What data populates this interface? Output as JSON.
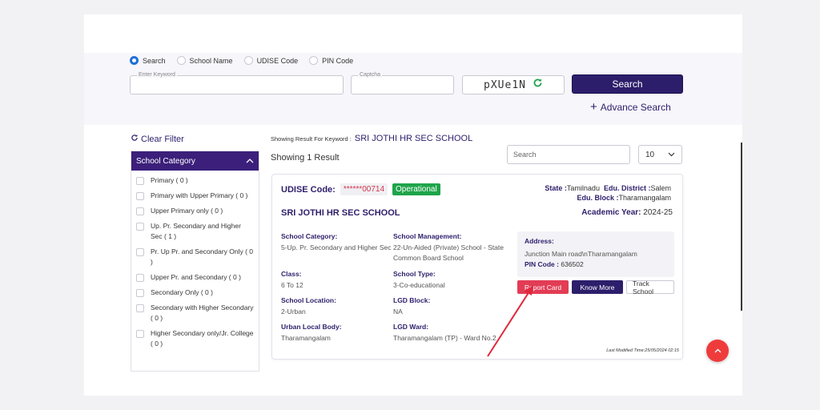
{
  "search_options": {
    "selected": "Search",
    "options": [
      "Search",
      "School Name",
      "UDISE Code",
      "PIN Code"
    ]
  },
  "search_form": {
    "keyword_label": "Enter Keyword",
    "captcha_label": "Captcha",
    "captcha_text": "pXUe1N",
    "search_button": "Search",
    "advance_search": "Advance Search"
  },
  "filter": {
    "clear_filter": "Clear Filter",
    "section_title": "School Category",
    "items": [
      "Primary ( 0 )",
      "Primary with Upper Primary ( 0 )",
      "Upper Primary only ( 0 )",
      "Up. Pr. Secondary and Higher Sec ( 1 )",
      "Pr. Up Pr. and Secondary Only ( 0 )",
      "Upper Pr. and Secondary ( 0 )",
      "Secondary Only ( 0 )",
      "Secondary with Higher Secondary ( 0 )",
      "Higher Secondary only/Jr. College ( 0 )"
    ]
  },
  "results": {
    "keyword_prefix": "Showing Result For Keyword :",
    "keyword": "SRI JOTHI HR SEC SCHOOL",
    "count_text": "Showing 1 Result",
    "search_placeholder": "Search",
    "per_page": "10"
  },
  "school": {
    "udise_label": "UDISE Code:",
    "udise_value": "******00714",
    "status": "Operational",
    "state_label": "State :",
    "state": "Tamilnadu",
    "district_label": "Edu. District :",
    "district": "Salem",
    "block_label": "Edu. Block :",
    "block": "Tharamangalam",
    "name": "SRI JOTHI HR SEC SCHOOL",
    "academic_year_label": "Academic Year:",
    "academic_year": "2024-25",
    "fields": {
      "category_label": "School Category:",
      "category": "5-Up. Pr. Secondary and Higher Sec",
      "management_label": "School Management:",
      "management": "22-Un-Aided (Private) School - State Common Board School",
      "class_label": "Class:",
      "class": "6 To 12",
      "type_label": "School Type:",
      "type": "3-Co-educational",
      "location_label": "School Location:",
      "location": "2-Urban",
      "lgd_block_label": "LGD Block:",
      "lgd_block": "NA",
      "ulb_label": "Urban Local Body:",
      "ulb": "Tharamangalam",
      "lgd_ward_label": "LGD Ward:",
      "lgd_ward": "Tharamangalam (TP) - Ward No.2"
    },
    "address_label": "Address:",
    "address": "Junction Main road\\nTharamangalam",
    "pin_label": "PIN Code :",
    "pin": "636502",
    "buttons": {
      "report_card": "Report Card",
      "know_more": "Know More",
      "track_school": "Track School"
    },
    "last_modified": "Last Modified Time:25/05/2024 02:15"
  },
  "colors": {
    "brand": "#2d1e6b",
    "header": "#3b1f7a",
    "report": "#e33c55",
    "operational": "#1ea44a",
    "fab": "#ef3b3b",
    "annotation_arrow": "#e0283c"
  },
  "icons": {
    "refresh": "refresh-icon",
    "plus": "plus-icon",
    "chevron": "chevron-down-icon",
    "scroll_top": "chevron-up-icon"
  }
}
